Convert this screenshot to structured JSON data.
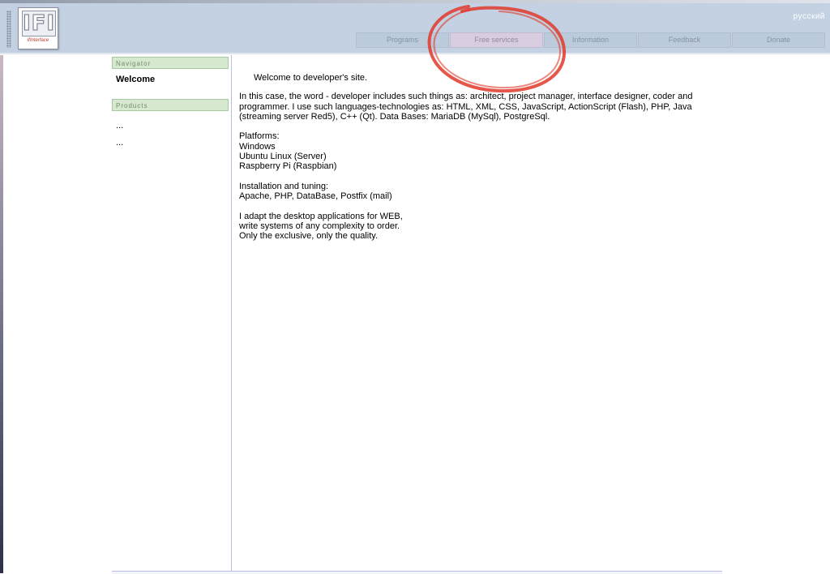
{
  "header": {
    "logo_mark": "IFI",
    "logo_text": "ifInterface",
    "language_link": "русский"
  },
  "nav": {
    "items": [
      {
        "label": "Programs"
      },
      {
        "label": "Free services"
      },
      {
        "label": "Information"
      },
      {
        "label": "Feedback"
      },
      {
        "label": "Donate"
      }
    ],
    "active": "Free services"
  },
  "sidebar": {
    "navigator_header": "Navigator",
    "navigator_items": [
      {
        "label": "Welcome"
      }
    ],
    "products_header": "Products",
    "products_items": [
      {
        "label": "..."
      },
      {
        "label": "..."
      }
    ]
  },
  "main": {
    "intro": "Welcome to developer's site.",
    "paragraphs": [
      "In this case, the word - developer includes such things as: architect, project manager, interface designer, coder and programmer. I use such languages-technologies as: HTML, XML, CSS, JavaScript, ActionScript (Flash), PHP, Java (streaming server Red5), C++ (Qt). Data Bases: MariaDB (MySql), PostgreSql.",
      "Platforms:\nWindows\nUbuntu Linux (Server)\nRaspberry Pi (Raspbian)",
      "Installation and tuning:\nApache, PHP, DataBase, Postfix (mail)",
      "I adapt the desktop applications for WEB,\nwrite systems of any complexity to order.\nOnly the exclusive, only the quality."
    ]
  },
  "colors": {
    "header_bg": "#c3d1e2",
    "nav_button": "#bccbdc",
    "nav_active": "#d8cde0",
    "sidebar_header_bg": "#d6e8d0",
    "annotation_circle": "#e0392b"
  }
}
